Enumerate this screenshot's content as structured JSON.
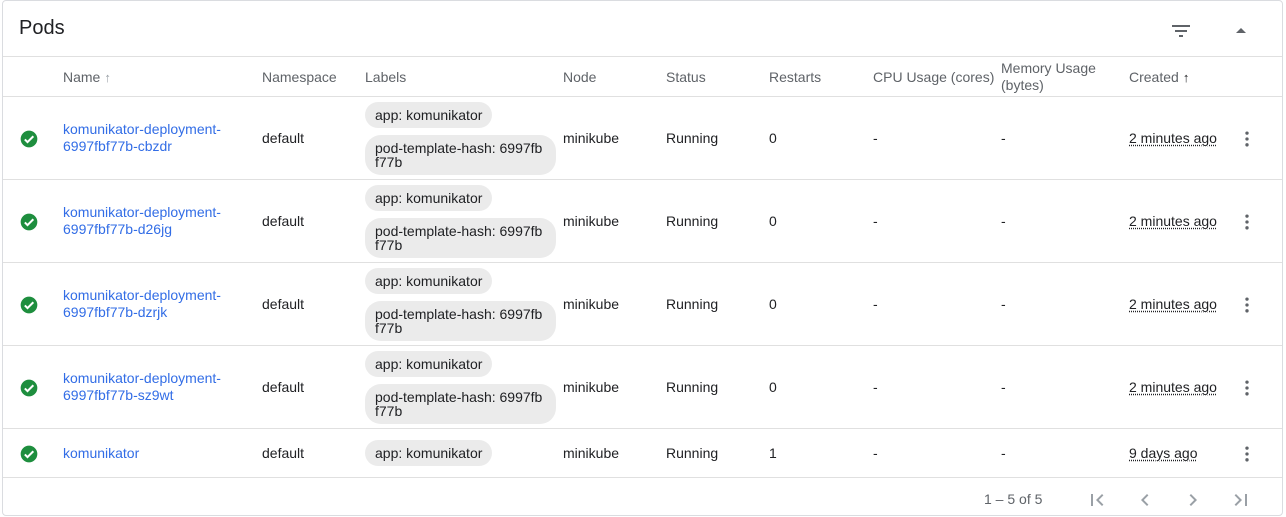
{
  "card": {
    "title": "Pods"
  },
  "columns": {
    "name": "Name",
    "namespace": "Namespace",
    "labels": "Labels",
    "node": "Node",
    "status": "Status",
    "restarts": "Restarts",
    "cpu": "CPU Usage (cores)",
    "memory": "Memory Usage (bytes)",
    "created": "Created"
  },
  "sort_arrows": {
    "name": "↑",
    "created": "↑"
  },
  "rows": [
    {
      "name": "komunikator-deployment-6997fbf77b-cbzdr",
      "namespace": "default",
      "label_app": "app: komunikator",
      "label_hash": "pod-template-hash: 6997fbf77b",
      "node": "minikube",
      "status": "Running",
      "restarts": "0",
      "cpu": "-",
      "memory": "-",
      "created": "2 minutes ago"
    },
    {
      "name": "komunikator-deployment-6997fbf77b-d26jg",
      "namespace": "default",
      "label_app": "app: komunikator",
      "label_hash": "pod-template-hash: 6997fbf77b",
      "node": "minikube",
      "status": "Running",
      "restarts": "0",
      "cpu": "-",
      "memory": "-",
      "created": "2 minutes ago"
    },
    {
      "name": "komunikator-deployment-6997fbf77b-dzrjk",
      "namespace": "default",
      "label_app": "app: komunikator",
      "label_hash": "pod-template-hash: 6997fbf77b",
      "node": "minikube",
      "status": "Running",
      "restarts": "0",
      "cpu": "-",
      "memory": "-",
      "created": "2 minutes ago"
    },
    {
      "name": "komunikator-deployment-6997fbf77b-sz9wt",
      "namespace": "default",
      "label_app": "app: komunikator",
      "label_hash": "pod-template-hash: 6997fbf77b",
      "node": "minikube",
      "status": "Running",
      "restarts": "0",
      "cpu": "-",
      "memory": "-",
      "created": "2 minutes ago"
    },
    {
      "name": "komunikator",
      "namespace": "default",
      "label_app": "app: komunikator",
      "label_hash": "",
      "node": "minikube",
      "status": "Running",
      "restarts": "1",
      "cpu": "-",
      "memory": "-",
      "created": "9 days ago"
    }
  ],
  "footer": {
    "range": "1 – 5 of 5"
  },
  "icons": {
    "status": "check-circle-icon",
    "filter": "filter-list-icon",
    "collapse": "arrow-drop-up-icon",
    "row_menu": "more-vert-icon",
    "first_page": "first-page-icon",
    "prev_page": "chevron-left-icon",
    "next_page": "chevron-right-icon",
    "last_page": "last-page-icon"
  },
  "colors": {
    "link": "#326de6",
    "success": "#1e8e3e",
    "chip": "#ebebeb"
  }
}
